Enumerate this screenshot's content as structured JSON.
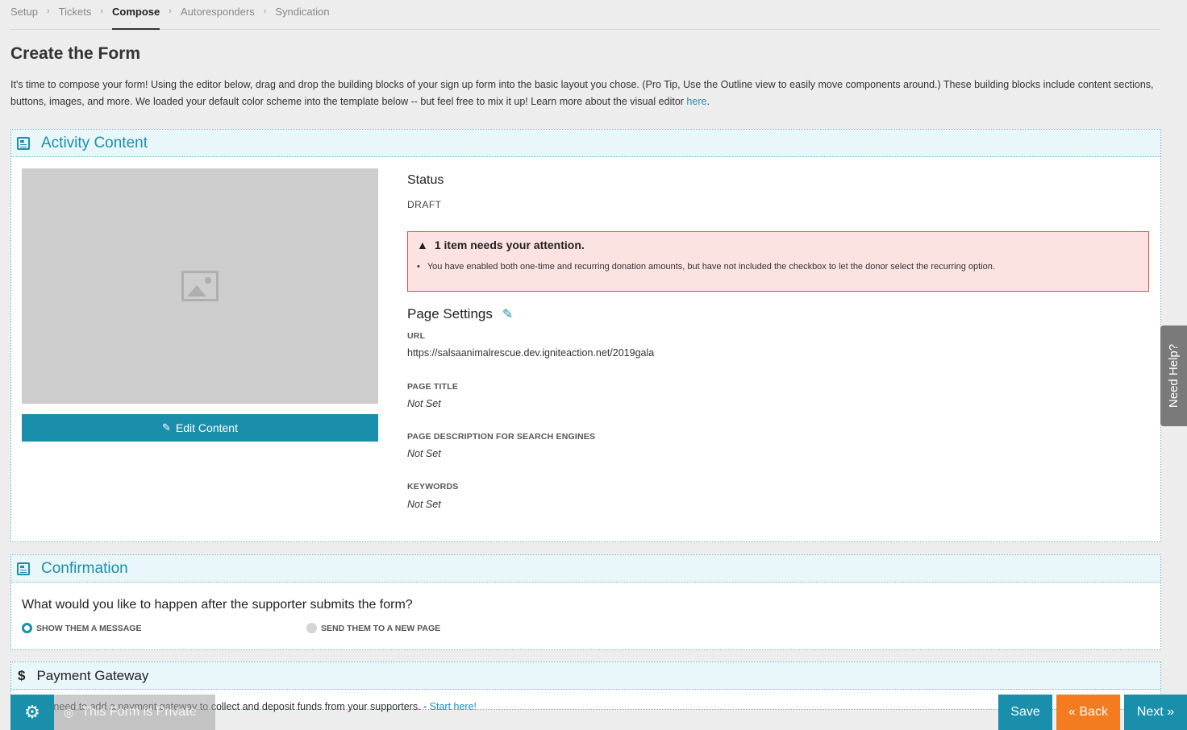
{
  "breadcrumb": {
    "items": [
      "Setup",
      "Tickets",
      "Compose",
      "Autoresponders",
      "Syndication"
    ],
    "separator": "›",
    "active": "Compose"
  },
  "page": {
    "title": "Create the Form",
    "intro_text": "It's time to compose your form! Using the editor below, drag and drop the building blocks of your sign up form into the basic layout you chose. (Pro Tip, Use the Outline view to easily move components around.) These building blocks include content sections, buttons, images, and more. We loaded your default color scheme into the template below -- but feel free to mix it up! Learn more about the visual editor ",
    "intro_link": "here",
    "intro_end": "."
  },
  "activity": {
    "title": "Activity Content",
    "edit_button": "Edit Content",
    "status_label": "Status",
    "status_value": "DRAFT",
    "alert_title": "1 item needs your attention.",
    "alert_item": "You have enabled both one-time and recurring donation amounts, but have not included the checkbox to let the donor select the recurring option.",
    "page_settings_label": "Page Settings",
    "url_label": "URL",
    "url_value": "https://salsaanimalrescue.dev.igniteaction.net/2019gala",
    "page_title_label": "PAGE TITLE",
    "page_title_value": "Not Set",
    "description_label": "PAGE DESCRIPTION FOR SEARCH ENGINES",
    "description_value": "Not Set",
    "keywords_label": "KEYWORDS",
    "keywords_value": "Not Set"
  },
  "confirmation": {
    "title": "Confirmation",
    "question": "What would you like to happen after the supporter submits the form?",
    "option_message": "SHOW THEM A MESSAGE",
    "option_page": "SEND THEM TO A NEW PAGE",
    "selected": "SHOW THEM A MESSAGE"
  },
  "payment": {
    "title": "Payment Gateway",
    "note": "'ll need to add a payment gateway to collect and deposit funds from your supporters. - ",
    "link": "Start here!"
  },
  "bottom_bar": {
    "private_label": "This Form is Private",
    "save": "Save",
    "back": "« Back",
    "next": "Next »"
  },
  "help_tab": "Need Help?",
  "icons": {
    "panel": "form-icon",
    "image": "image-placeholder-icon",
    "edit": "pencil-icon",
    "warning": "warning-icon",
    "gear": "gear-icon",
    "eye": "eye-slash-icon",
    "dollar": "dollar-icon"
  },
  "colors": {
    "accent": "#1a8fac",
    "back_button": "#f47b20",
    "alert_bg": "#fde2e2",
    "alert_border": "#d9534f"
  }
}
